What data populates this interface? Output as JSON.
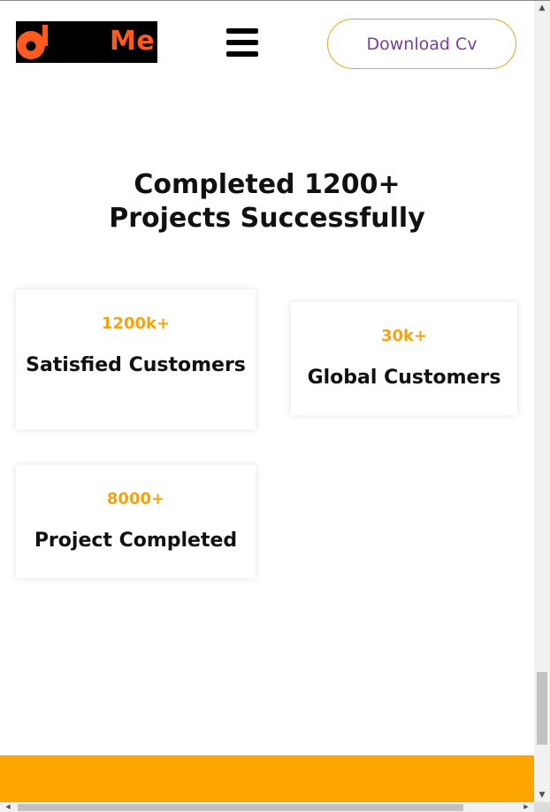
{
  "header": {
    "logo_text": "Me",
    "menu_icon": "hamburger-menu-icon",
    "download_label": "Download Cv"
  },
  "section": {
    "title_line1": "Completed 1200+",
    "title_line2": "Projects Successfully"
  },
  "stats": [
    {
      "value": "1200k+",
      "label": "Satisfied Customers"
    },
    {
      "value": "30k+",
      "label": "Global Customers"
    },
    {
      "value": "8000+",
      "label": "Project Completed"
    }
  ],
  "colors": {
    "accent": "#ffa500",
    "stat_number": "#f5a20f",
    "logo_orange": "#ff5a1f",
    "button_text": "#7b3d98",
    "button_border": "#e9a51a"
  }
}
